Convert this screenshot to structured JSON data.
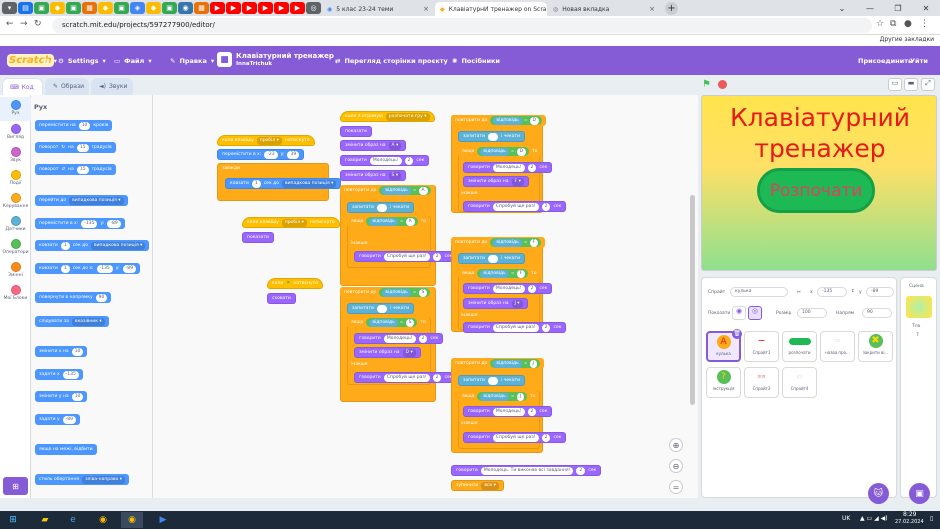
{
  "browser": {
    "tabs": [
      {
        "label": "5 клас 23-24 теми",
        "active": false
      },
      {
        "label": "КлавіатурнИ тренажер on Scra",
        "active": true
      },
      {
        "label": "Новая вкладка",
        "active": false
      }
    ],
    "url": "scratch.mit.edu/projects/597277900/editor/",
    "bookmarks_right": "Другие закладки"
  },
  "menubar": {
    "logo": "Scratch",
    "settings": "Settings",
    "file": "Файл",
    "edit": "Правка",
    "project_title": "Клавіатурний тренажер",
    "author": "InnaTrichuk",
    "see_project": "Перегляд сторінки проєкту",
    "tutorials": "Посібники",
    "share": "Присоединить",
    "exit": "Уйти"
  },
  "editor_tabs": {
    "code": "Код",
    "costumes": "Образи",
    "sounds": "Звуки"
  },
  "categories": [
    {
      "label": "Рух",
      "color": "#4c97ff"
    },
    {
      "label": "Вигляд",
      "color": "#9966ff"
    },
    {
      "label": "Звук",
      "color": "#cf63cf"
    },
    {
      "label": "Події",
      "color": "#ffbf00"
    },
    {
      "label": "Керування",
      "color": "#ffab19"
    },
    {
      "label": "Датчики",
      "color": "#5cb1d6"
    },
    {
      "label": "Оператори",
      "color": "#59c059"
    },
    {
      "label": "Змінні",
      "color": "#ff8c1a"
    },
    {
      "label": "Мої Блоки",
      "color": "#ff6680"
    }
  ],
  "palette": {
    "heading": "Рух",
    "move": "перемістити на",
    "move_val": "10",
    "steps": "кроків",
    "turn_r": "поворот",
    "turn_r_val": "15",
    "degrees": "градусів",
    "turn_l": "поворот",
    "turn_l_val": "15",
    "goto": "перейти до",
    "goto_dd": "випадкова позиція",
    "goto_xy": "перемістити в x:",
    "gx": "-135",
    "gy_label": "y:",
    "gy": "-89",
    "glide": "ковзати",
    "glide_s": "1",
    "glide_sec": "сек до",
    "glide_dd": "випадкова позиція",
    "glide_xy": "ковзати",
    "glide_xy_s": "1",
    "glide_xy_mid": "сек до x:",
    "glide_xy_x": "-135",
    "glide_xy_y": "-89",
    "point": "повернути в напрямку",
    "point_val": "90",
    "towards": "слідувати за",
    "towards_dd": "вказівник",
    "chx": "змінити x на",
    "chx_val": "10",
    "setx": "задати x",
    "setx_val": "-135",
    "chy": "змінити у на",
    "chy_val": "10",
    "sety": "задати у",
    "sety_val": "-89",
    "bounce": "якщо на межі, відбити",
    "rotstyle": "стиль обертання",
    "rotstyle_dd": "зліва-направо"
  },
  "scripts": {
    "when_key": "коли клавішу",
    "key_any": "пробіл",
    "pressed": "натиснуто",
    "goto_xy": "перемістити в x:",
    "x1": "-23",
    "y_lbl": "y:",
    "y1": "39",
    "forever": "завжди",
    "glide": "ковзати",
    "glide_s": "1",
    "sec_to": "сек до",
    "random_pos": "випадкова позиція",
    "when_key2": "коли клавішу",
    "key2": "пробіл",
    "pressed2": "натиснуто",
    "show": "показати",
    "when_flag": "коли",
    "flag_clicked": "натиснуто",
    "hide": "сховати",
    "receive": "коли я отримую",
    "msg": "розпочати гру",
    "show2": "показати",
    "set_costume": "змінити образ на",
    "c_a": "A",
    "say": "говорити",
    "molodets": "Молодець!",
    "two": "2",
    "sec": "сек",
    "set_costume2": "змінити образ на",
    "c_s": "S",
    "repeat_until": "повторити до",
    "answer": "відповідь",
    "eq": "=",
    "ask": "запитати",
    "wait": "і чекати",
    "if": "якщо",
    "then": "то",
    "try_again": "Спробуй ще раз!",
    "else": "інакше",
    "final_say": "Молодець. Ти виконав всі завдання!",
    "stop": "зупинити",
    "stop_dd": "все"
  },
  "stage": {
    "title": "Клавіатурний тренажер",
    "button": "Розпочати"
  },
  "sprite_info": {
    "sprite_label": "Спрайт",
    "sprite_name": "кулька",
    "x_label": "x",
    "x": "-135",
    "y_label": "y",
    "y": "-89",
    "show_label": "Показати",
    "size_label": "Розмір",
    "size": "100",
    "dir_label": "Напрям",
    "dir": "90"
  },
  "sprites": [
    {
      "name": "кулька",
      "selected": true
    },
    {
      "name": "Спрайт1",
      "selected": false
    },
    {
      "name": "розпочати",
      "selected": false
    },
    {
      "name": "назва про...",
      "selected": false
    },
    {
      "name": "закрити ві...",
      "selected": false
    },
    {
      "name": "інструкція",
      "selected": false
    },
    {
      "name": "Спрайт3",
      "selected": false
    },
    {
      "name": "Спрайт4",
      "selected": false
    }
  ],
  "stage_pane": {
    "label": "Сцена",
    "backdrops_label": "Тло",
    "backdrops": "7"
  },
  "taskbar": {
    "lang": "UK",
    "time": "8:29",
    "date": "27.02.2024"
  }
}
